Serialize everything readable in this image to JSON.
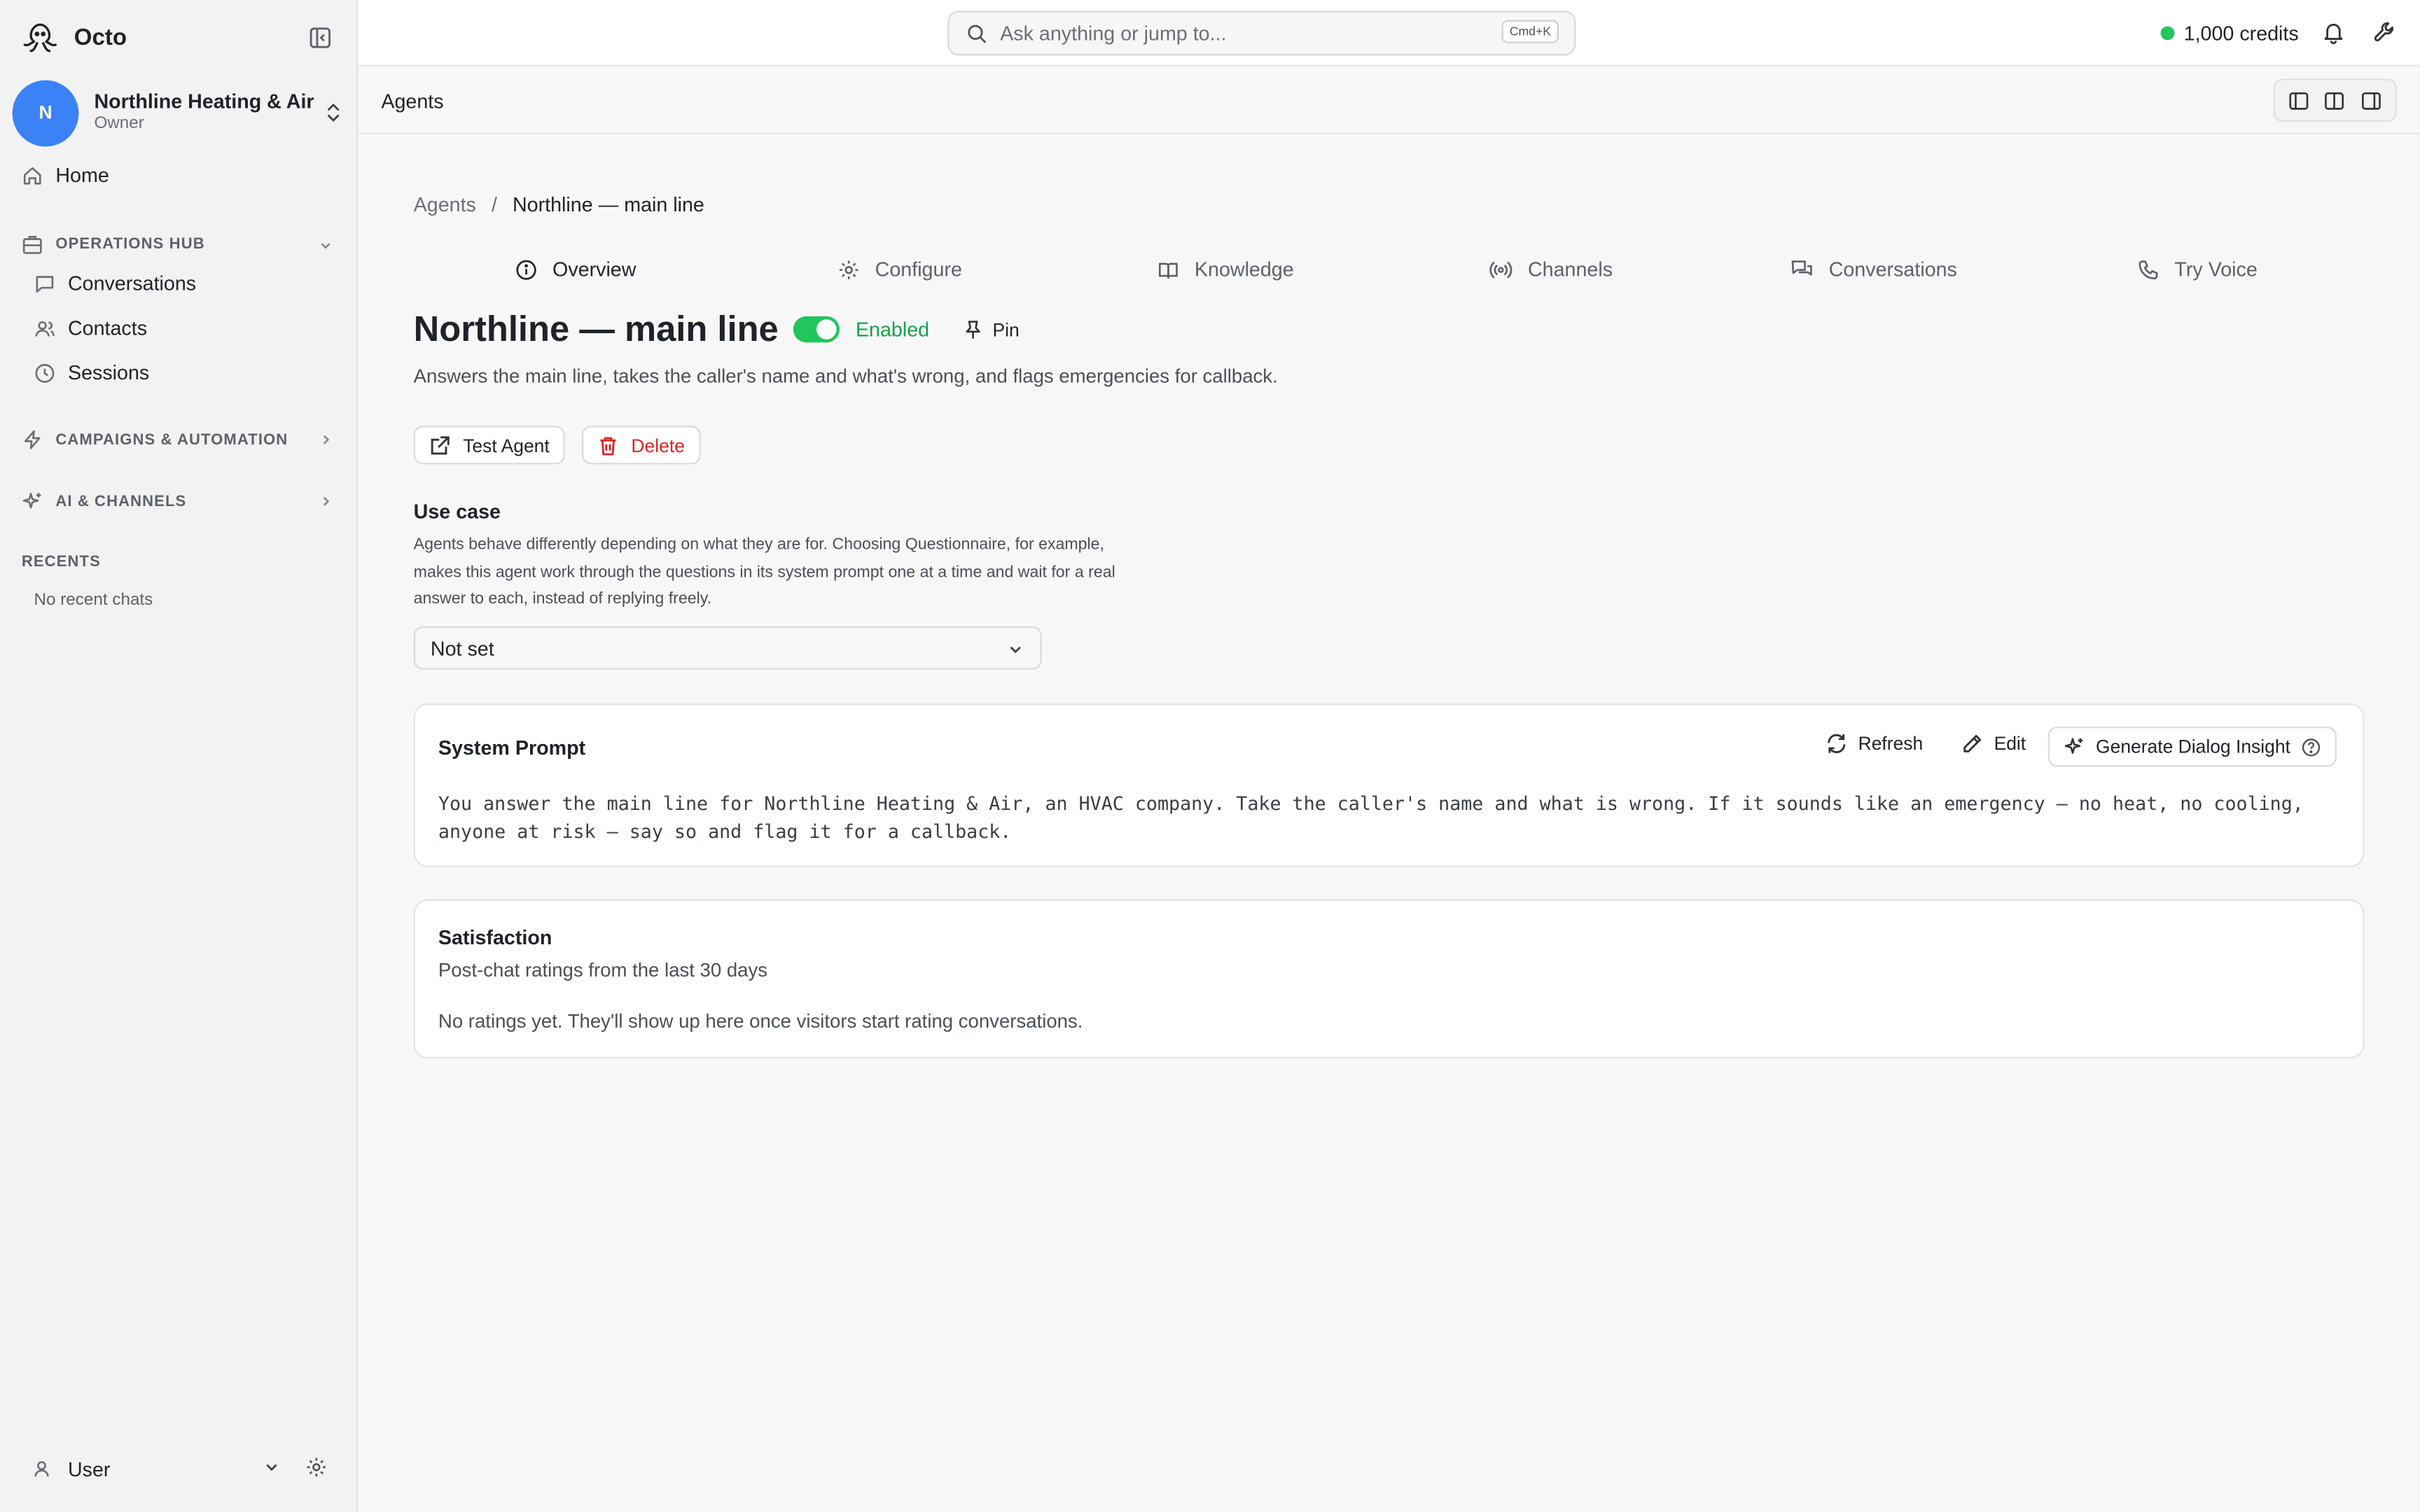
{
  "app": {
    "name": "Octo"
  },
  "org": {
    "name": "Northline Heating & Air",
    "role": "Owner",
    "initial": "N",
    "avatar_color": "#3b82f6"
  },
  "sidebar": {
    "home": "Home",
    "operations_hub": {
      "label": "OPERATIONS HUB",
      "items": [
        "Conversations",
        "Contacts",
        "Sessions"
      ]
    },
    "campaigns": "CAMPAIGNS & AUTOMATION",
    "ai_channels": "AI & CHANNELS",
    "recents": {
      "label": "RECENTS",
      "empty": "No recent chats"
    },
    "user": "User"
  },
  "topbar": {
    "search_placeholder": "Ask anything or jump to...",
    "shortcut": "Cmd+K",
    "credits": "1,000 credits",
    "credits_status_color": "#22c55e"
  },
  "page": {
    "title": "Agents"
  },
  "breadcrumb": {
    "root": "Agents",
    "separator": "/",
    "current": "Northline — main line"
  },
  "tabs": [
    "Overview",
    "Configure",
    "Knowledge",
    "Channels",
    "Conversations",
    "Try Voice"
  ],
  "agent": {
    "name": "Northline — main line",
    "status": "Enabled",
    "pin": "Pin",
    "description": "Answers the main line, takes the caller's name and what's wrong, and flags emergencies for callback.",
    "test_button": "Test Agent",
    "delete_button": "Delete"
  },
  "use_case": {
    "label": "Use case",
    "help": "Agents behave differently depending on what they are for. Choosing Questionnaire, for example, makes this agent work through the questions in its system prompt one at a time and wait for a real answer to each, instead of replying freely.",
    "selected": "Not set"
  },
  "system_prompt": {
    "title": "System Prompt",
    "refresh": "Refresh",
    "edit": "Edit",
    "insight": "Generate Dialog Insight",
    "text": "You answer the main line for Northline Heating & Air, an HVAC company. Take the caller's name and what is wrong. If it sounds like an emergency — no heat, no cooling, anyone at risk — say so and flag it for a callback."
  },
  "satisfaction": {
    "title": "Satisfaction",
    "subtitle": "Post-chat ratings from the last 30 days",
    "empty": "No ratings yet. They'll show up here once visitors start rating conversations."
  },
  "colors": {
    "accent_green": "#22c55e",
    "danger": "#dc2626"
  }
}
